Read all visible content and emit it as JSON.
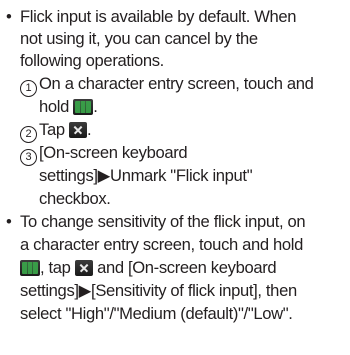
{
  "bullet_char": "•",
  "items": [
    {
      "lines": [
        "Flick input is available by default. When",
        "not using it, you can cancel by the",
        "following operations."
      ],
      "steps": [
        {
          "num": "1",
          "text_a": "On a character entry screen, touch and",
          "text_b": "hold",
          "text_c": "."
        },
        {
          "num": "2",
          "text_a": "Tap",
          "text_c": "."
        },
        {
          "num": "3",
          "text_a": "[On-screen keyboard",
          "text_b": "settings]▶Unmark \"Flick input\"",
          "text_c": "checkbox."
        }
      ]
    },
    {
      "line1": "To change sensitivity of the flick input, on",
      "line2": "a character entry screen, touch and hold",
      "line3_after_icon1": ", tap",
      "line3_after_icon2": "and [On-screen keyboard",
      "line4": "settings]▶[Sensitivity of flick input], then",
      "line5": "select \"High\"/\"Medium (default)\"/\"Low\"."
    }
  ],
  "icons": {
    "keyboard_key": "keyboard-key-icon",
    "close_key": "close-key-icon"
  }
}
